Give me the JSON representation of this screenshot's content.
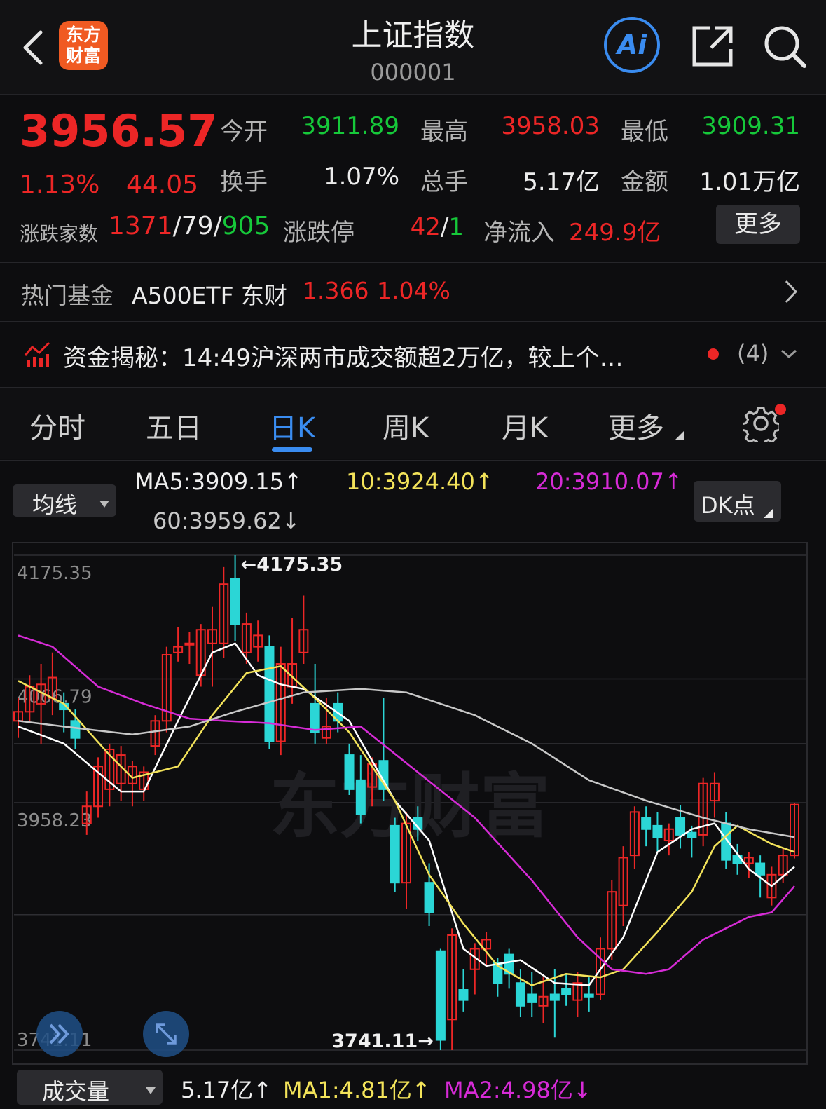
{
  "header": {
    "title": "上证指数",
    "code": "000001",
    "logo_line1": "东方",
    "logo_line2": "财富",
    "ai_label": "Ai"
  },
  "quote": {
    "price": "3956.57",
    "change_pct": "1.13%",
    "change": "44.05",
    "open_label": "今开",
    "open": "3911.89",
    "high_label": "最高",
    "high": "3958.03",
    "low_label": "最低",
    "low": "3909.31",
    "turnover_label": "换手",
    "turnover": "1.07%",
    "volume_label": "总手",
    "volume": "5.17亿",
    "amount_label": "金额",
    "amount": "1.01万亿",
    "breadth_label": "涨跌家数",
    "up_count": "1371",
    "flat_count": "79",
    "down_count": "905",
    "limit_label": "涨跌停",
    "limit_up": "42",
    "limit_down": "1",
    "inflow_label": "净流入",
    "inflow": "249.9亿",
    "more_button": "更多"
  },
  "fund": {
    "label": "热门基金",
    "name": "A500ETF 东财",
    "price": "1.366",
    "pct": "1.04%"
  },
  "news": {
    "text": "资金揭秘：14:49沪深两市成交额超2万亿，较上个…",
    "count": "(4)"
  },
  "tabs": [
    "分时",
    "五日",
    "日K",
    "周K",
    "月K",
    "更多"
  ],
  "ma_bar": {
    "selector": "均线",
    "ma5": "MA5:3909.15↑",
    "ma10": "10:3924.40↑",
    "ma20": "20:3910.07↑",
    "ma60": "60:3959.62↓",
    "dk_button": "DK点"
  },
  "colors": {
    "up": "#ec2626",
    "down": "#2bd6d6",
    "ma5": "#ffffff",
    "ma10": "#f3e35a",
    "ma20": "#d62bd6",
    "ma60": "#c8c8c8",
    "accent": "#3a8cf0",
    "logo": "#f05a22"
  },
  "chart_data": {
    "type": "candlestick",
    "y_axis_labels": [
      "4175.35",
      "4066.79",
      "3958.23",
      "3741.11"
    ],
    "ylim": [
      3741.11,
      4175.35
    ],
    "max_marker": "←4175.35",
    "min_marker": "3741.11→",
    "watermark": "东方财富",
    "candles": [
      {
        "o": 4030,
        "c": 4038,
        "h": 4050,
        "l": 4015
      },
      {
        "o": 4038,
        "c": 4060,
        "h": 4070,
        "l": 4030
      },
      {
        "o": 4045,
        "c": 4062,
        "h": 4080,
        "l": 4010
      },
      {
        "o": 4050,
        "c": 4068,
        "h": 4090,
        "l": 4035
      },
      {
        "o": 4045,
        "c": 4040,
        "h": 4055,
        "l": 4020
      },
      {
        "o": 4030,
        "c": 4015,
        "h": 4040,
        "l": 4005
      },
      {
        "o": 3940,
        "c": 3955,
        "h": 3968,
        "l": 3930
      },
      {
        "o": 3955,
        "c": 3990,
        "h": 3998,
        "l": 3945
      },
      {
        "o": 3970,
        "c": 4005,
        "h": 4010,
        "l": 3955
      },
      {
        "o": 3975,
        "c": 4000,
        "h": 4008,
        "l": 3960
      },
      {
        "o": 3975,
        "c": 3990,
        "h": 3995,
        "l": 3955
      },
      {
        "o": 3970,
        "c": 3985,
        "h": 3990,
        "l": 3960
      },
      {
        "o": 4008,
        "c": 4030,
        "h": 4035,
        "l": 4000
      },
      {
        "o": 4030,
        "c": 4088,
        "h": 4095,
        "l": 4020
      },
      {
        "o": 4090,
        "c": 4095,
        "h": 4112,
        "l": 4082
      },
      {
        "o": 4098,
        "c": 4098,
        "h": 4108,
        "l": 4080
      },
      {
        "o": 4070,
        "c": 4110,
        "h": 4115,
        "l": 4060
      },
      {
        "o": 4098,
        "c": 4110,
        "h": 4130,
        "l": 4060
      },
      {
        "o": 4098,
        "c": 4150,
        "h": 4165,
        "l": 4085
      },
      {
        "o": 4155,
        "c": 4115,
        "h": 4175.35,
        "l": 4100
      },
      {
        "o": 4090,
        "c": 4115,
        "h": 4125,
        "l": 4080
      },
      {
        "o": 4095,
        "c": 4105,
        "h": 4118,
        "l": 4082
      },
      {
        "o": 4095,
        "c": 4012,
        "h": 4105,
        "l": 4005
      },
      {
        "o": 4012,
        "c": 4080,
        "h": 4095,
        "l": 4000
      },
      {
        "o": 4060,
        "c": 4080,
        "h": 4120,
        "l": 4045
      },
      {
        "o": 4090,
        "c": 4110,
        "h": 4140,
        "l": 4080
      },
      {
        "o": 4045,
        "c": 4020,
        "h": 4080,
        "l": 4010
      },
      {
        "o": 4015,
        "c": 4025,
        "h": 4050,
        "l": 4010
      },
      {
        "o": 4045,
        "c": 4030,
        "h": 4055,
        "l": 4020
      },
      {
        "o": 4000,
        "c": 3970,
        "h": 4010,
        "l": 3965
      },
      {
        "o": 3978,
        "c": 3948,
        "h": 4000,
        "l": 3940
      },
      {
        "o": 3972,
        "c": 3992,
        "h": 3998,
        "l": 3955
      },
      {
        "o": 3995,
        "c": 3970,
        "h": 4050,
        "l": 3960
      },
      {
        "o": 3938,
        "c": 3888,
        "h": 3945,
        "l": 3880
      },
      {
        "o": 3888,
        "c": 3940,
        "h": 3950,
        "l": 3865
      },
      {
        "o": 3945,
        "c": 3935,
        "h": 3955,
        "l": 3925
      },
      {
        "o": 3888,
        "c": 3862,
        "h": 3905,
        "l": 3850
      },
      {
        "o": 3828,
        "c": 3750,
        "h": 3830,
        "l": 3741.11
      },
      {
        "o": 3768,
        "c": 3842,
        "h": 3848,
        "l": 3741.11
      },
      {
        "o": 3794,
        "c": 3785,
        "h": 3812,
        "l": 3775
      },
      {
        "o": 3812,
        "c": 3830,
        "h": 3835,
        "l": 3790
      },
      {
        "o": 3830,
        "c": 3838,
        "h": 3845,
        "l": 3815
      },
      {
        "o": 3818,
        "c": 3800,
        "h": 3822,
        "l": 3788
      },
      {
        "o": 3825,
        "c": 3808,
        "h": 3830,
        "l": 3795
      },
      {
        "o": 3800,
        "c": 3780,
        "h": 3812,
        "l": 3770
      },
      {
        "o": 3790,
        "c": 3783,
        "h": 3810,
        "l": 3770
      },
      {
        "o": 3780,
        "c": 3788,
        "h": 3805,
        "l": 3765
      },
      {
        "o": 3790,
        "c": 3785,
        "h": 3812,
        "l": 3752
      },
      {
        "o": 3795,
        "c": 3790,
        "h": 3808,
        "l": 3780
      },
      {
        "o": 3785,
        "c": 3800,
        "h": 3810,
        "l": 3770
      },
      {
        "o": 3790,
        "c": 3788,
        "h": 3805,
        "l": 3775
      },
      {
        "o": 3790,
        "c": 3830,
        "h": 3840,
        "l": 3785
      },
      {
        "o": 3830,
        "c": 3880,
        "h": 3890,
        "l": 3820
      },
      {
        "o": 3868,
        "c": 3910,
        "h": 3920,
        "l": 3850
      },
      {
        "o": 3912,
        "c": 3950,
        "h": 3955,
        "l": 3900
      },
      {
        "o": 3945,
        "c": 3935,
        "h": 3955,
        "l": 3920
      },
      {
        "o": 3938,
        "c": 3928,
        "h": 3950,
        "l": 3915
      },
      {
        "o": 3925,
        "c": 3935,
        "h": 3940,
        "l": 3912
      },
      {
        "o": 3945,
        "c": 3930,
        "h": 3956,
        "l": 3918
      },
      {
        "o": 3932,
        "c": 3928,
        "h": 3938,
        "l": 3910
      },
      {
        "o": 3930,
        "c": 3975,
        "h": 3980,
        "l": 3920
      },
      {
        "o": 3960,
        "c": 3975,
        "h": 3985,
        "l": 3945
      },
      {
        "o": 3940,
        "c": 3908,
        "h": 3950,
        "l": 3900
      },
      {
        "o": 3912,
        "c": 3905,
        "h": 3922,
        "l": 3895
      },
      {
        "o": 3905,
        "c": 3910,
        "h": 3915,
        "l": 3892
      },
      {
        "o": 3905,
        "c": 3895,
        "h": 3912,
        "l": 3875
      },
      {
        "o": 3875,
        "c": 3895,
        "h": 3902,
        "l": 3868
      },
      {
        "o": 3895,
        "c": 3912,
        "h": 3918,
        "l": 3888
      },
      {
        "o": 3912,
        "c": 3956.57,
        "h": 3958.03,
        "l": 3909.31
      }
    ],
    "ma_series": [
      {
        "name": "MA5",
        "color": "#ffffff",
        "points": [
          [
            0,
            4025
          ],
          [
            4,
            4010
          ],
          [
            9,
            3968
          ],
          [
            11,
            3968
          ],
          [
            14,
            4030
          ],
          [
            17,
            4090
          ],
          [
            19,
            4098
          ],
          [
            21,
            4070
          ],
          [
            23,
            4062
          ],
          [
            25,
            4058
          ],
          [
            29,
            4030
          ],
          [
            33,
            3960
          ],
          [
            36,
            3925
          ],
          [
            39,
            3830
          ],
          [
            41,
            3815
          ],
          [
            44,
            3820
          ],
          [
            47,
            3800
          ],
          [
            50,
            3798
          ],
          [
            53,
            3840
          ],
          [
            56,
            3915
          ],
          [
            59,
            3935
          ],
          [
            61,
            3940
          ],
          [
            64,
            3900
          ],
          [
            66,
            3885
          ],
          [
            68,
            3902
          ]
        ]
      },
      {
        "name": "MA10",
        "color": "#f3e35a",
        "points": [
          [
            0,
            4065
          ],
          [
            4,
            4045
          ],
          [
            8,
            4000
          ],
          [
            10,
            3980
          ],
          [
            14,
            3990
          ],
          [
            17,
            4035
          ],
          [
            20,
            4072
          ],
          [
            23,
            4078
          ],
          [
            26,
            4050
          ],
          [
            29,
            4020
          ],
          [
            33,
            3960
          ],
          [
            36,
            3895
          ],
          [
            39,
            3852
          ],
          [
            42,
            3815
          ],
          [
            45,
            3798
          ],
          [
            48,
            3808
          ],
          [
            51,
            3805
          ],
          [
            53,
            3812
          ],
          [
            56,
            3845
          ],
          [
            59,
            3880
          ],
          [
            61,
            3920
          ],
          [
            63,
            3938
          ],
          [
            66,
            3922
          ],
          [
            68,
            3915
          ]
        ]
      },
      {
        "name": "MA20",
        "color": "#d62bd6",
        "points": [
          [
            0,
            4105
          ],
          [
            3,
            4095
          ],
          [
            7,
            4060
          ],
          [
            11,
            4045
          ],
          [
            15,
            4032
          ],
          [
            18,
            4030
          ],
          [
            22,
            4028
          ],
          [
            26,
            4022
          ],
          [
            30,
            4025
          ],
          [
            35,
            3985
          ],
          [
            40,
            3945
          ],
          [
            45,
            3890
          ],
          [
            49,
            3840
          ],
          [
            52,
            3812
          ],
          [
            55,
            3808
          ],
          [
            57,
            3812
          ],
          [
            60,
            3838
          ],
          [
            64,
            3858
          ],
          [
            66,
            3862
          ],
          [
            68,
            3885
          ]
        ]
      },
      {
        "name": "MA60",
        "color": "#c8c8c8",
        "points": [
          [
            0,
            4030
          ],
          [
            4,
            4025
          ],
          [
            10,
            4018
          ],
          [
            15,
            4025
          ],
          [
            19,
            4038
          ],
          [
            25,
            4055
          ],
          [
            30,
            4058
          ],
          [
            34,
            4055
          ],
          [
            40,
            4035
          ],
          [
            45,
            4010
          ],
          [
            50,
            3978
          ],
          [
            55,
            3960
          ],
          [
            60,
            3945
          ],
          [
            64,
            3935
          ],
          [
            68,
            3928
          ]
        ]
      }
    ]
  },
  "volume_bar": {
    "selector": "成交量",
    "vol": "5.17亿↑",
    "ma1": "MA1:4.81亿↑",
    "ma2": "MA2:4.98亿↓"
  }
}
